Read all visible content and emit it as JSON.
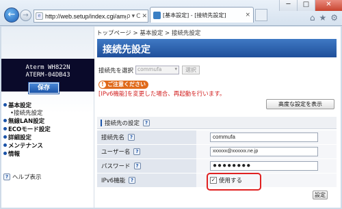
{
  "browser": {
    "url": "http://web.setup/index.cgi/amg",
    "addr_controls": [
      "ρ",
      "▾",
      "C",
      "✕"
    ],
    "tab_title": "[基本設定] - [接続先設定]",
    "tab_close": "×",
    "window_buttons": [
      "─",
      "□",
      "✕"
    ],
    "tools": [
      "⌂",
      "★",
      "⚙"
    ]
  },
  "sidebar": {
    "model_line1": "Aterm WH822N",
    "model_line2": "ATERM-04DB43",
    "save_label": "保存",
    "menu": [
      {
        "label": "基本設定",
        "sub": [
          "•接続先設定"
        ]
      },
      {
        "label": "無線LAN設定"
      },
      {
        "label": "ECOモード設定"
      },
      {
        "label": "詳細設定"
      },
      {
        "label": "メンテナンス"
      },
      {
        "label": "情報"
      }
    ],
    "help_label": "ヘルプ表示"
  },
  "main": {
    "breadcrumb": "トップページ > 基本設定 > 接続先設定",
    "title": "接続先設定",
    "select_label": "接続先を選択",
    "select_value": "commufa",
    "select_button": "選択",
    "warning_badge": "ご注意ください",
    "warning_text": "[IPv6機能]を変更した場合、再起動を行います。",
    "advanced_button": "高度な設定を表示",
    "section_title": "接続先の設定",
    "fields": [
      {
        "label": "接続先名",
        "value": "commufa",
        "help": true
      },
      {
        "label": "ユーザー名",
        "value": "xxxxxx@xxxxxx.ne.jp",
        "help": true
      },
      {
        "label": "パスワード",
        "value": "●●●●●●●●",
        "help": true
      },
      {
        "label": "IPv6機能",
        "value": "使用する",
        "help": true,
        "checked": true
      }
    ],
    "set_button": "設定"
  },
  "help_glyph": "?",
  "check_glyph": "✓",
  "colors": {
    "title_bar": "#2a5fab",
    "warning": "#e06a1b",
    "warning_text": "#d21f1f",
    "highlight": "#e02020"
  }
}
